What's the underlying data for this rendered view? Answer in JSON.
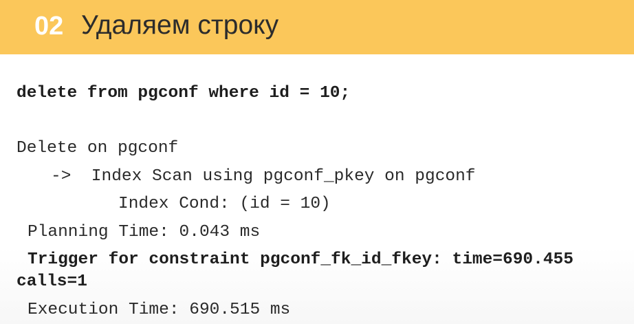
{
  "header": {
    "number": "02",
    "title": "Удаляем строку"
  },
  "code": {
    "query": "delete from pgconf where id = 10;",
    "plan_line_1": "Delete on pgconf",
    "plan_line_2": "->  Index Scan using pgconf_pkey on pgconf",
    "plan_line_3": "Index Cond: (id = 10)",
    "planning_time": "Planning Time: 0.043 ms",
    "trigger_line": "Trigger for constraint pgconf_fk_id_fkey: time=690.455",
    "trigger_calls": "calls=1",
    "execution_time": "Execution Time: 690.515 ms"
  },
  "colors": {
    "header_background": "#fbc75a",
    "header_number": "#ffffff",
    "header_title": "#2c2c2c",
    "code_text": "#2a2a2a"
  }
}
